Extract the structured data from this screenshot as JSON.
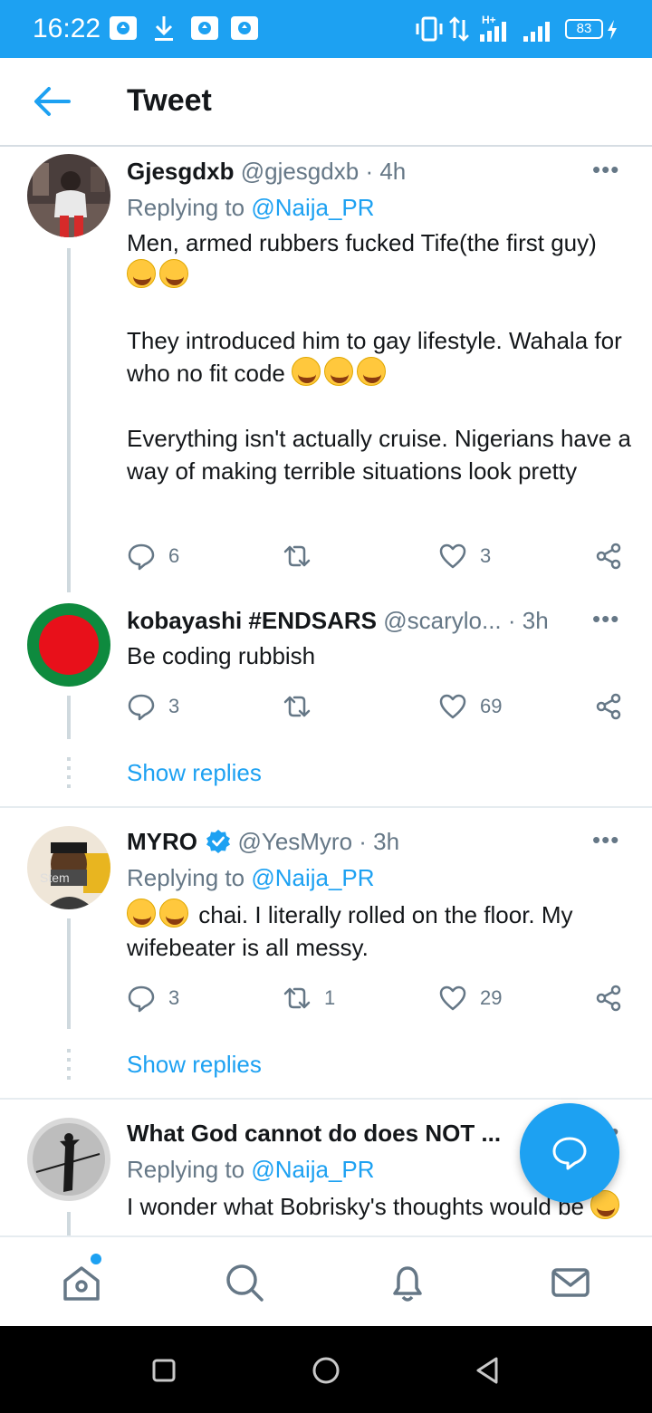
{
  "status_bar": {
    "time": "16:22",
    "battery": "83"
  },
  "header": {
    "title": "Tweet"
  },
  "tweets": [
    {
      "name": "Gjesgdxb",
      "handle": "@gjesgdxb",
      "time": "· 4h",
      "replying_prefix": "Replying to ",
      "replying_to": "@Naija_PR",
      "paragraphs": [
        "Men, armed rubbers fucked Tife(the first guy)",
        "They introduced him to gay lifestyle. Wahala for who no fit code",
        "Everything isn't actually cruise. Nigerians have a way of making terrible situations look pretty"
      ],
      "replies": "6",
      "retweets": "",
      "likes": "3"
    },
    {
      "name": "kobayashi #ENDSARS",
      "handle": "@scarylo...",
      "time": "· 3h",
      "text": "Be coding rubbish",
      "replies": "3",
      "retweets": "",
      "likes": "69",
      "show_replies": "Show replies"
    },
    {
      "name": "MYRO",
      "handle": "@YesMyro",
      "time": "· 3h",
      "replying_prefix": "Replying to ",
      "replying_to": "@Naija_PR",
      "text": "chai. I literally rolled on the floor. My wifebeater is all messy.",
      "replies": "3",
      "retweets": "1",
      "likes": "29",
      "show_replies": "Show replies"
    },
    {
      "name": "What God cannot do does NOT ...",
      "handle": "",
      "time": "",
      "replying_prefix": "Replying to ",
      "replying_to": "@Naija_PR",
      "text": "I wonder what Bobrisky's thoughts would be"
    }
  ],
  "colors": {
    "brand": "#1da1f2",
    "text_primary": "#14171a",
    "text_secondary": "#657786",
    "verified": "#1da1f2"
  },
  "icons": {
    "back": "arrow-left-icon",
    "more": "more-horizontal-icon",
    "reply": "reply-icon",
    "retweet": "retweet-icon",
    "like": "heart-icon",
    "share": "share-icon",
    "compose": "compose-reply-icon",
    "nav": [
      "home-icon",
      "search-icon",
      "notifications-icon",
      "messages-icon"
    ]
  }
}
